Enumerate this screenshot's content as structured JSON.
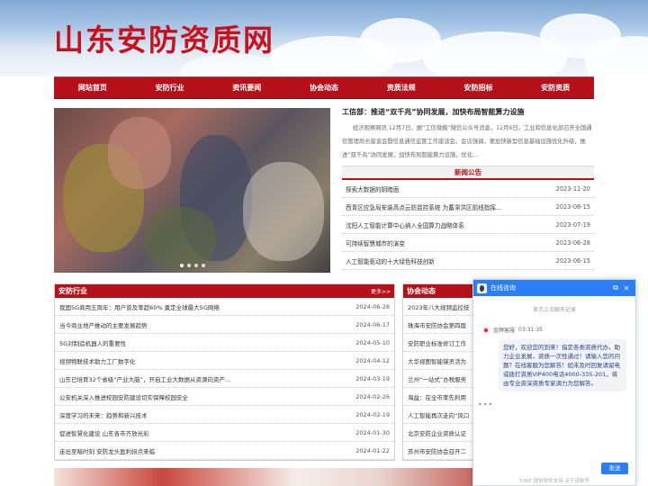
{
  "site": {
    "title": "山东安防资质网"
  },
  "nav": [
    "网站首页",
    "安防行业",
    "资讯要闻",
    "协会动态",
    "资质法规",
    "安防招标",
    "安防资质"
  ],
  "hero": {
    "dots": 4,
    "active_dot": 0
  },
  "headline": {
    "title": "工信部：推进“双千兆”协同发展，加快布局智能算力设施",
    "body": "经济观察网讯 12月7日，据“工信微报”微信公众号消息，12月6日，工业和信息化部召开全国通信管理局长座谈会暨信息通信监管工作座谈会。会议强调，要加快新型信息基础设施优化升级，推进“双千兆”协同发展，加快布局智能算力设施，优化..."
  },
  "notice": {
    "heading": "新闻公告",
    "items": [
      {
        "title": "探索大数据的阴暗面",
        "date": "2023-11-20"
      },
      {
        "title": "西青区应急局安装高点云防监控系统 为蓄滞洪区前线指挥...",
        "date": "2023-08-15"
      },
      {
        "title": "沈阳人工智能计算中心纳入全国算力战略体系",
        "date": "2023-07-19"
      },
      {
        "title": "可持续智慧城市的演变",
        "date": "2023-06-28"
      },
      {
        "title": "人工智能驱动的十大绿色科技创新",
        "date": "2023-06-15"
      }
    ]
  },
  "industry": {
    "heading": "安防行业",
    "more": "更多>>",
    "items": [
      {
        "title": "我国5G商用五周年：用户普及率超60% 奠定全球最大5G网络",
        "date": "2024-06-28"
      },
      {
        "title": "当今商业地产推动的主要发展趋势",
        "date": "2024-06-17"
      },
      {
        "title": "5G对制造机器人的重要性",
        "date": "2024-05-10"
      },
      {
        "title": "视频物联技术助力工厂数字化",
        "date": "2024-04-12"
      },
      {
        "title": "山东已培育32个省级“产业大脑”，开启工业大数据从资源向资产...",
        "date": "2024-03-19"
      },
      {
        "title": "公安机关深入推进校园安防建设切实保障校园安全",
        "date": "2024-02-26"
      },
      {
        "title": "深度学习的未来：趋势和新兴技术",
        "date": "2024-02-19"
      },
      {
        "title": "促进智慧化建设 山东各市齐放光彩",
        "date": "2024-01-30"
      },
      {
        "title": "走出至暗时刻 安防龙头盈利拐点来临",
        "date": "2024-01-22"
      }
    ]
  },
  "association": {
    "heading": "协会动态",
    "items": [
      {
        "title": "2023年八大视频监控技",
        "date": ""
      },
      {
        "title": "珠海市安防协会第四届",
        "date": ""
      },
      {
        "title": "安防职业标准修订工作",
        "date": ""
      },
      {
        "title": "大华视图智能镜灵活为",
        "date": ""
      },
      {
        "title": "兰州“一站式”办税服务",
        "date": ""
      },
      {
        "title": "海益：在全市率先利用",
        "date": ""
      },
      {
        "title": "人工智能再次走向“风口",
        "date": ""
      },
      {
        "title": "北京安防企业资质认证",
        "date": ""
      },
      {
        "title": "苏州市安防协会召开二",
        "date": ""
      }
    ]
  },
  "chat": {
    "title": "在线咨询",
    "history": "显示上次聊天记录",
    "agent": "金牌客服",
    "time": "03:31:35",
    "message": "您好，欢迎您的到来！指定各类资质代办，助力企业发展，资质一次性通过！请输入您的问题？在线客服为您解答！如未及时回复请留电或拨打资质VIP400电话4000-335-201，将由专业资深资质专家调力为您解答。",
    "send": "发送",
    "powered": "53KF 提供软件支持  关于该账号"
  }
}
